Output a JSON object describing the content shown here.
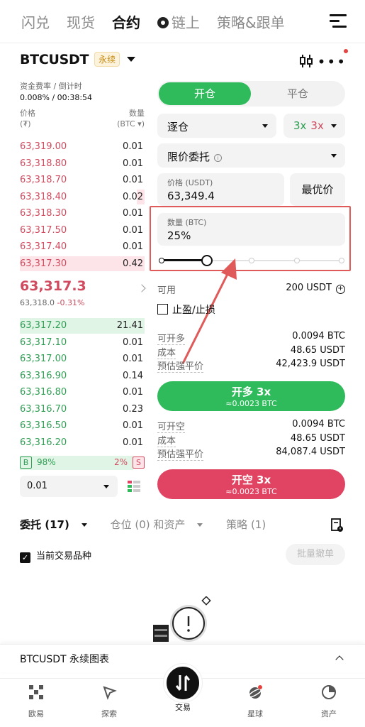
{
  "topnav": {
    "items": [
      "闪兑",
      "现货",
      "合约",
      "链上",
      "策略&跟单"
    ],
    "active_index": 2
  },
  "symbol": {
    "name": "BTCUSDT",
    "badge": "永续"
  },
  "funding": {
    "label": "资金费率 / 倒计时",
    "value": "0.008% / 00:38:54"
  },
  "orderbook": {
    "price_header": "价格",
    "price_unit": "(₮)",
    "qty_header": "数量",
    "qty_unit": "(BTC ▾)",
    "asks": [
      {
        "price": "63,319.00",
        "qty": "0.01",
        "depth": 0
      },
      {
        "price": "63,318.80",
        "qty": "0.01",
        "depth": 0
      },
      {
        "price": "63,318.70",
        "qty": "0.01",
        "depth": 0
      },
      {
        "price": "63,318.40",
        "qty": "0.02",
        "depth": 0.06
      },
      {
        "price": "63,318.30",
        "qty": "0.01",
        "depth": 0
      },
      {
        "price": "63,317.50",
        "qty": "0.01",
        "depth": 0
      },
      {
        "price": "63,317.40",
        "qty": "0.01",
        "depth": 0
      },
      {
        "price": "63,317.30",
        "qty": "0.42",
        "depth": 1.0
      }
    ],
    "mid_price": "63,317.3",
    "mark_price": "63,318.0",
    "change": "-0.31%",
    "bids": [
      {
        "price": "63,317.20",
        "qty": "21.41",
        "depth": 1.0
      },
      {
        "price": "63,317.10",
        "qty": "0.01",
        "depth": 0
      },
      {
        "price": "63,317.00",
        "qty": "0.01",
        "depth": 0
      },
      {
        "price": "63,316.90",
        "qty": "0.14",
        "depth": 0
      },
      {
        "price": "63,316.80",
        "qty": "0.01",
        "depth": 0
      },
      {
        "price": "63,316.70",
        "qty": "0.23",
        "depth": 0
      },
      {
        "price": "63,316.50",
        "qty": "0.01",
        "depth": 0
      },
      {
        "price": "63,316.20",
        "qty": "0.01",
        "depth": 0
      }
    ],
    "buy_label": "B",
    "buy_ratio": "98%",
    "sell_ratio": "2%",
    "sell_label": "S",
    "precision": "0.01"
  },
  "trade": {
    "open_tab": "开仓",
    "close_tab": "平仓",
    "margin_mode": "逐仓",
    "leverage_long": "3x",
    "leverage_short": "3x",
    "order_type": "限价委托",
    "price_label": "价格 (USDT)",
    "price_value": "63,349.4",
    "best_price": "最优价",
    "qty_label": "数量 (BTC)",
    "qty_value": "25%",
    "slider_fraction": 0.25,
    "available_label": "可用",
    "available_value": "200 USDT",
    "tpsl_label": "止盈/止损",
    "long_stats": [
      {
        "k": "可开多",
        "v": "0.0094 BTC"
      },
      {
        "k": "成本",
        "v": "48.65 USDT"
      },
      {
        "k": "预估强平价",
        "v": "42,423.9 USDT"
      }
    ],
    "long_button": "开多 3x",
    "long_sub": "≈0.0023 BTC",
    "short_stats": [
      {
        "k": "可开空",
        "v": "0.0094 BTC"
      },
      {
        "k": "成本",
        "v": "48.65 USDT"
      },
      {
        "k": "预估强平价",
        "v": "84,087.4 USDT"
      }
    ],
    "short_button": "开空 3x",
    "short_sub": "≈0.0023 BTC"
  },
  "tabs": {
    "orders": "委托 (17)",
    "positions": "仓位 (0) 和资产",
    "strategy": "策略 (1)"
  },
  "filter": {
    "current_only": "当前交易品种",
    "batch_cancel": "批量撤单"
  },
  "chart_bar": {
    "label": "BTCUSDT 永续图表"
  },
  "bottomnav": {
    "items": [
      "欧易",
      "探索",
      "交易",
      "星球",
      "资产"
    ]
  },
  "colors": {
    "green": "#2fbb5c",
    "red": "#e04462",
    "highlight": "#e05a5a"
  }
}
